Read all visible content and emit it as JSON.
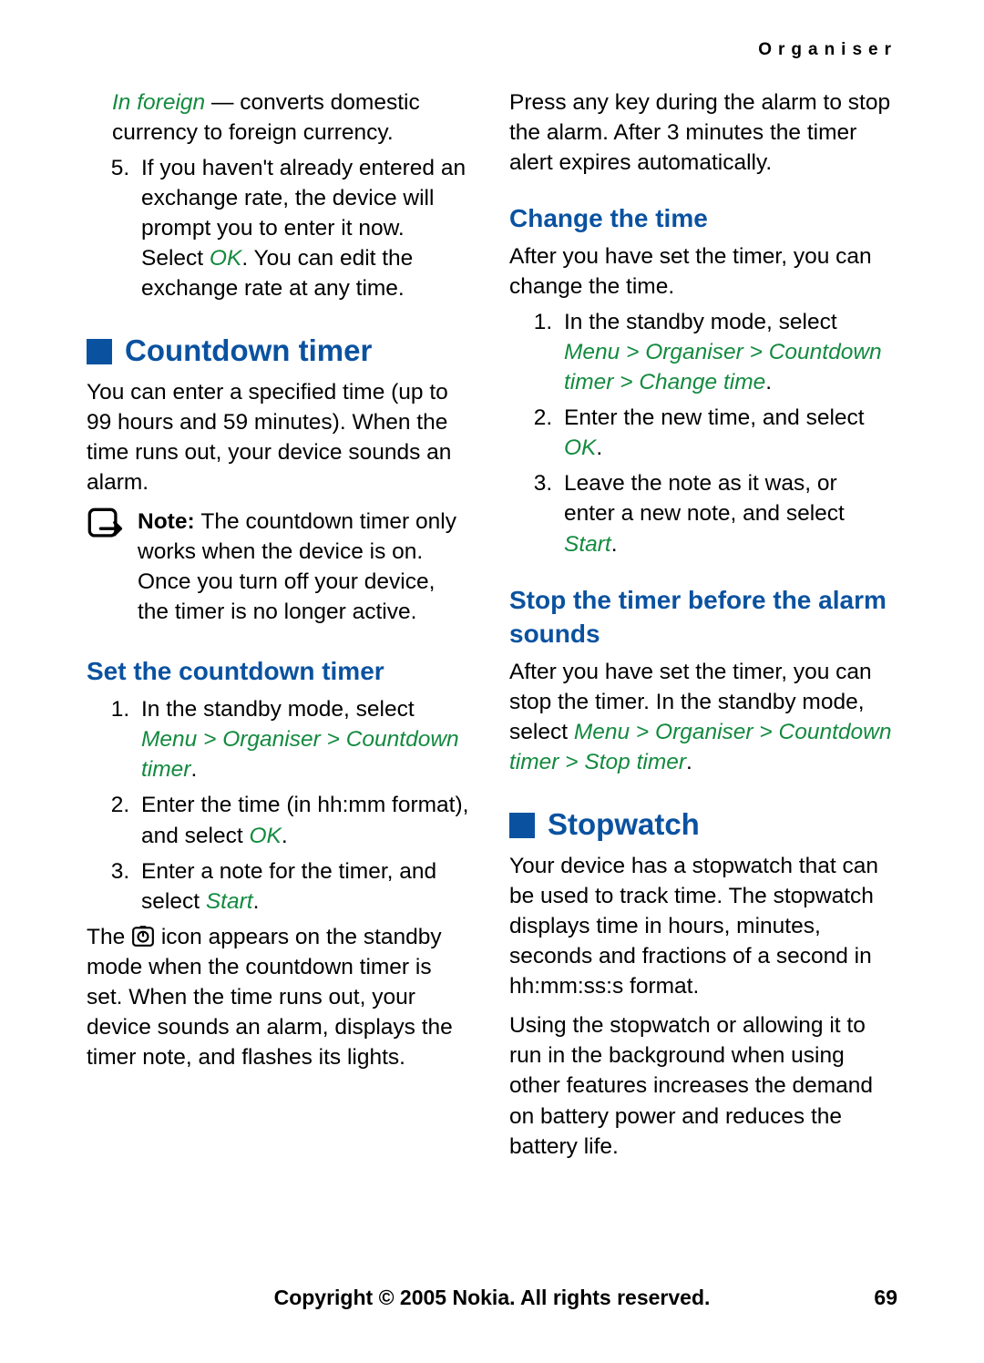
{
  "header": {
    "label": "Organiser"
  },
  "left": {
    "foreign_label": "In foreign",
    "foreign_desc": " — converts domestic currency to foreign currency.",
    "item5_before": "If you haven't already entered an exchange rate, the device will prompt you to enter it now. Select ",
    "item5_ok": "OK",
    "item5_after": ". You can edit the exchange rate at any time.",
    "countdown_h1": "Countdown timer",
    "countdown_p": "You can enter a specified time (up to 99 hours and 59 minutes). When the time runs out, your device sounds an alarm.",
    "note_label": "Note: ",
    "note_text": "The countdown timer only works when the device is on. Once you turn off your device, the timer is no longer active.",
    "set_h2": "Set the countdown timer",
    "set1_before": "In the standby mode, select ",
    "set1_path": "Menu > Organiser > Countdown timer",
    "set1_after": ".",
    "set2_before": "Enter the time (in hh:mm format), and select ",
    "set2_ok": "OK",
    "set2_after": ".",
    "set3_before": "Enter a note for the timer, and select ",
    "set3_start": "Start",
    "set3_after": ".",
    "standby_before": "The ",
    "standby_after": " icon appears on the standby mode when the countdown timer is set. When the time runs out, your device sounds an alarm, displays the timer note, and flashes its lights."
  },
  "right": {
    "alarm_p": "Press any key during the alarm to stop the alarm. After 3 minutes the timer alert expires automatically.",
    "change_h2": "Change the time",
    "change_p": "After you have set the timer, you can change the time.",
    "ch1_before": "In the standby mode, select ",
    "ch1_path": "Menu > Organiser > Countdown timer > Change time",
    "ch1_after": ".",
    "ch2_before": "Enter the new time, and select ",
    "ch2_ok": "OK",
    "ch2_after": ".",
    "ch3_before": "Leave the note as it was, or enter a new note, and select ",
    "ch3_start": "Start",
    "ch3_after": ".",
    "stop_h2": "Stop the timer before the alarm sounds",
    "stop_before": "After you have set the timer, you can stop the timer. In the standby mode, select ",
    "stop_path": "Menu > Organiser > Countdown timer > Stop timer",
    "stop_after": ".",
    "stopwatch_h1": "Stopwatch",
    "sw_p1": "Your device has a stopwatch that can be used to track time. The stopwatch displays time in hours, minutes, seconds and fractions of a second in hh:mm:ss:s format.",
    "sw_p2": "Using the stopwatch or allowing it to run in the background when using other features increases the demand on battery power and reduces the battery life."
  },
  "footer": {
    "text": "Copyright © 2005 Nokia. All rights reserved.",
    "page": "69"
  }
}
